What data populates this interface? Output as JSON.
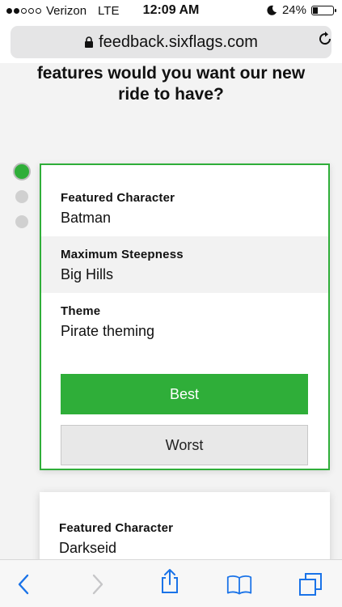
{
  "status_bar": {
    "carrier": "Verizon",
    "network": "LTE",
    "time": "12:09 AM",
    "battery": "24%"
  },
  "browser": {
    "url": "feedback.sixflags.com"
  },
  "question": {
    "line1": "features would you want our new",
    "line2": "ride to have?"
  },
  "progress": {
    "current": 1,
    "total": 3
  },
  "options": [
    {
      "attributes": [
        {
          "label": "Featured Character",
          "value": "Batman"
        },
        {
          "label": "Maximum Steepness",
          "value": "Big Hills"
        },
        {
          "label": "Theme",
          "value": "Pirate theming"
        }
      ],
      "best_label": "Best",
      "worst_label": "Worst"
    },
    {
      "attributes": [
        {
          "label": "Featured Character",
          "value": "Darkseid"
        }
      ]
    }
  ],
  "colors": {
    "accent_green": "#2fae39",
    "ios_blue": "#1a73e8"
  },
  "toolbar": {
    "icons": [
      "back-icon",
      "forward-icon",
      "share-icon",
      "bookmarks-icon",
      "tabs-icon"
    ]
  }
}
